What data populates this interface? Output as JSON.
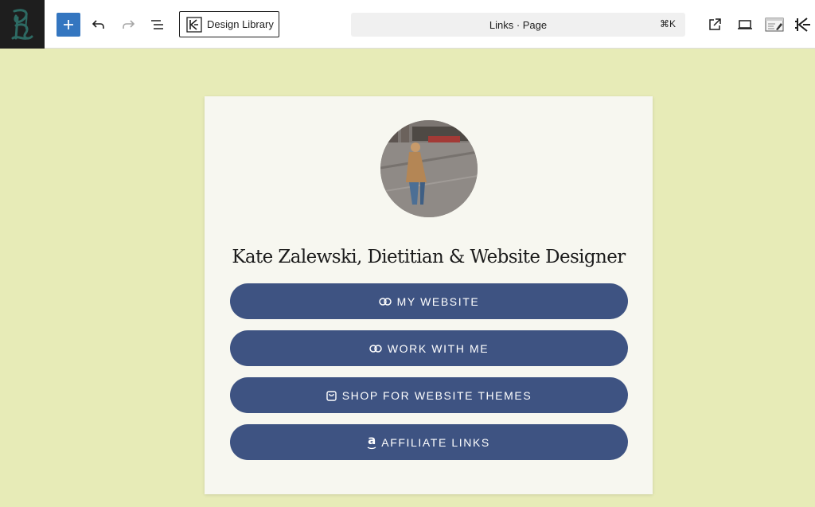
{
  "toolbar": {
    "design_library_label": "Design Library",
    "command_bar": {
      "title": "Links · Page",
      "shortcut": "⌘K"
    },
    "icons": {
      "site": "site-logo-icon",
      "add": "plus-icon",
      "undo": "undo-icon",
      "redo": "redo-icon",
      "list_view": "list-view-icon",
      "design_library": "kadence-design-library-icon",
      "view": "external-link-icon",
      "device": "laptop-icon",
      "editor": "editor-preview-icon",
      "kadence": "kadence-icon"
    },
    "accent_color": "#3476c0"
  },
  "profile": {
    "name": "Kate Zalewski, Dietitian & Website Designer"
  },
  "links": [
    {
      "label": "MY WEBSITE",
      "icon": "link-icon"
    },
    {
      "label": "WORK WITH ME",
      "icon": "link-icon"
    },
    {
      "label": "SHOP FOR WEBSITE THEMES",
      "icon": "shopping-bag-icon"
    },
    {
      "label": "AFFILIATE LINKS",
      "icon": "amazon-icon"
    }
  ],
  "colors": {
    "canvas_background": "#e7ebb7",
    "card_background": "#f7f7f0",
    "button_background": "#3e5382",
    "button_text": "#ffffff"
  }
}
